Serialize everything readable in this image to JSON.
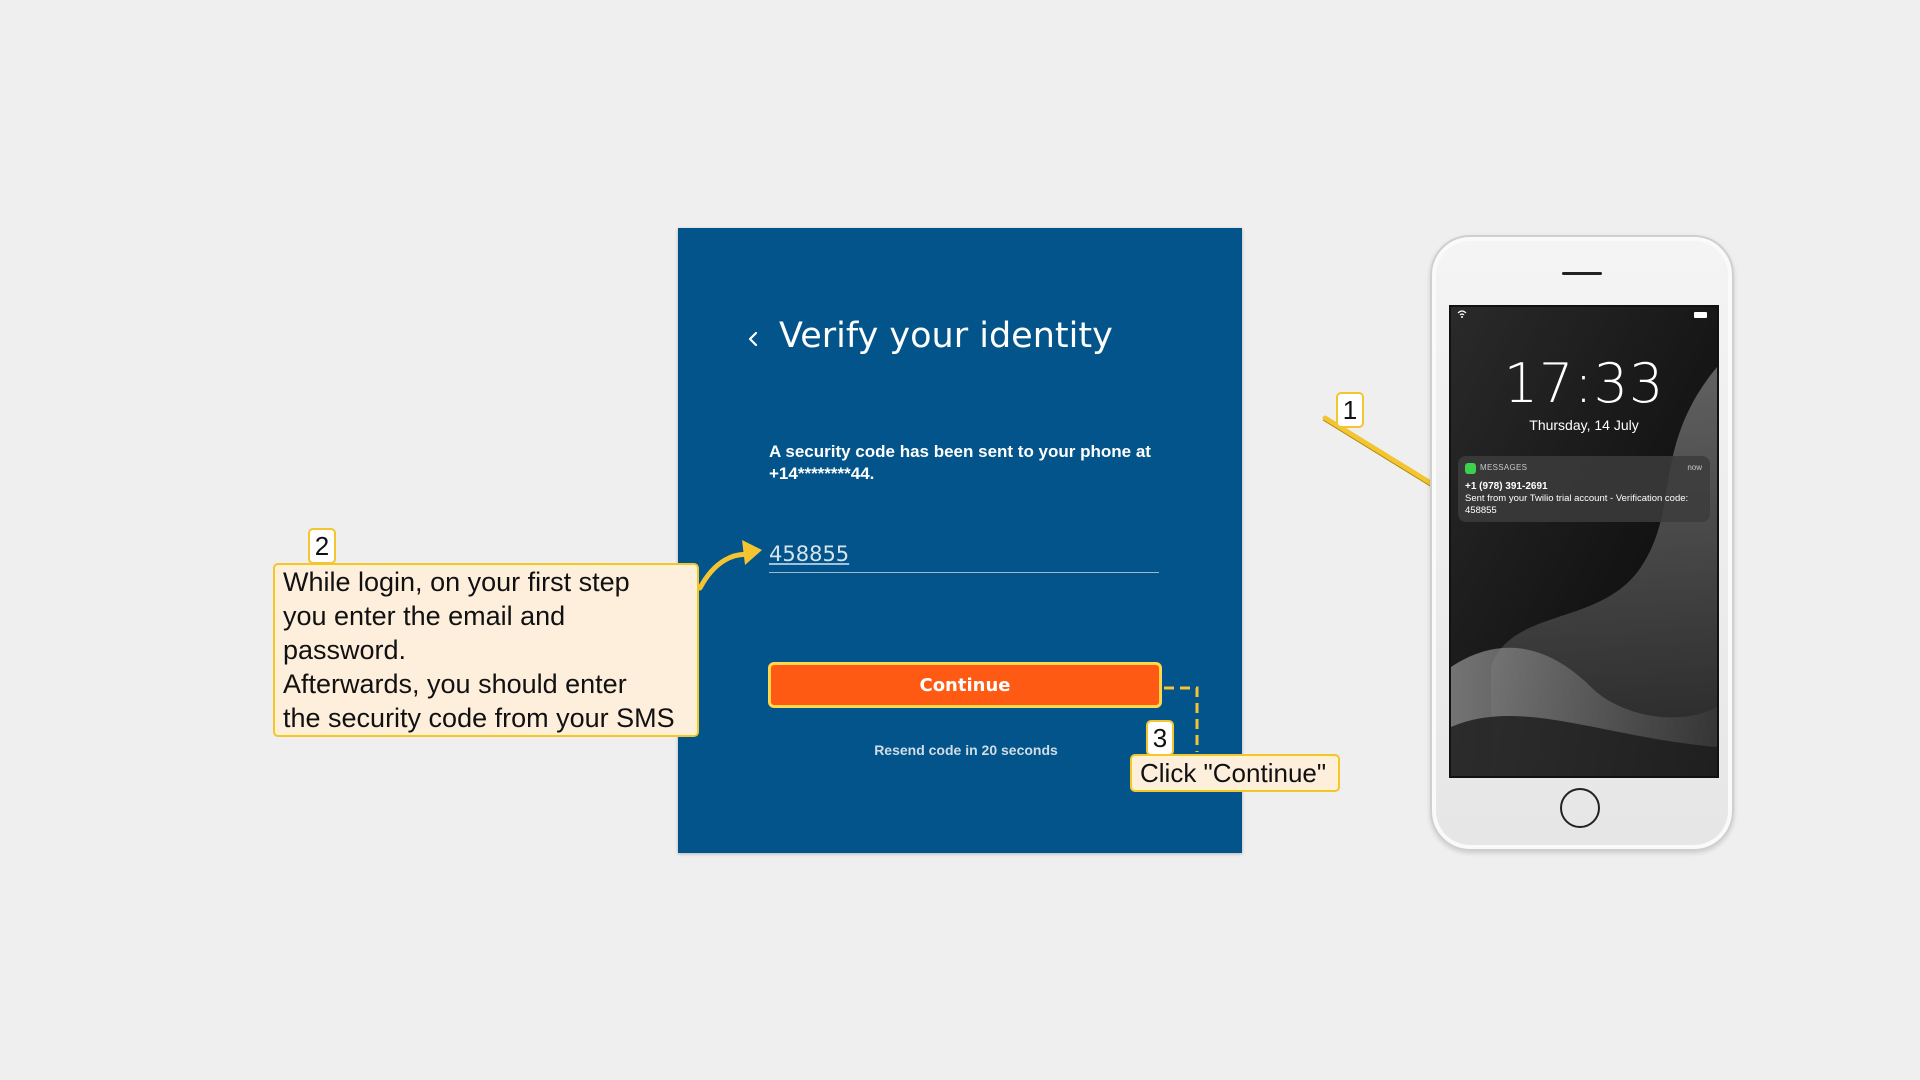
{
  "card": {
    "title": "Verify your identity",
    "back_icon": "chevron-left-icon",
    "message": "A security code has been sent to your phone at +14********44.",
    "code_value": "458855",
    "continue_label": "Continue",
    "resend_text": "Resend code in 20 seconds",
    "background_color": "#02548a",
    "button_color": "#ff5a13"
  },
  "annotations": {
    "step1_number": "1",
    "step2_number": "2",
    "step2_text_line1": "While login, on your first step",
    "step2_text_line2": "you enter the email and",
    "step2_text_line3": "password.",
    "step2_text_line4": "Afterwards, you should enter",
    "step2_text_line5": "the security code from your SMS",
    "step3_number": "3",
    "step3_text": "Click \"Continue\"",
    "highlight_color": "#f5c431"
  },
  "phone": {
    "time": "17:33",
    "date": "Thursday, 14 July",
    "notification": {
      "app": "MESSAGES",
      "time": "now",
      "sender": "+1 (978) 391-2691",
      "body": "Sent from your Twilio trial account - Verification code: 458855"
    }
  }
}
